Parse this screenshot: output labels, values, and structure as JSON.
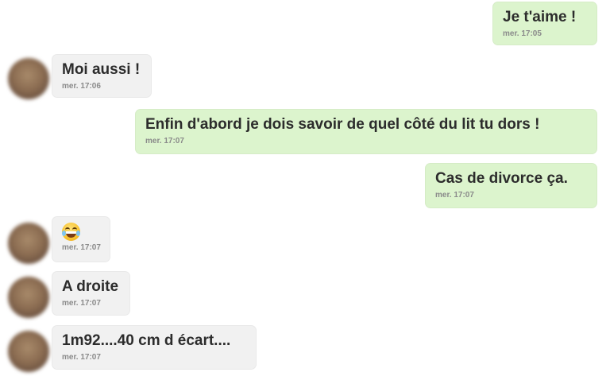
{
  "messages": [
    {
      "direction": "out",
      "text": "Je t'aime !",
      "time": "mer. 17:05"
    },
    {
      "direction": "in",
      "text": "Moi aussi !",
      "time": "mer. 17:06"
    },
    {
      "direction": "out",
      "text": "Enfin d'abord je dois savoir de quel côté du lit tu dors !",
      "time": "mer. 17:07"
    },
    {
      "direction": "out",
      "text": "Cas de divorce ça.",
      "time": "mer. 17:07"
    },
    {
      "direction": "in",
      "emoji": "laughing-tears-emoji",
      "time": "mer. 17:07"
    },
    {
      "direction": "in",
      "text": "A droite",
      "time": "mer. 17:07"
    },
    {
      "direction": "in",
      "text": "1m92....40 cm d écart....",
      "time": "mer. 17:07"
    }
  ],
  "colors": {
    "outgoing_bubble": "#dcf4cd",
    "incoming_bubble": "#f1f1f1",
    "message_text": "#2c2c2c",
    "timestamp_text": "#8a8a8a"
  }
}
